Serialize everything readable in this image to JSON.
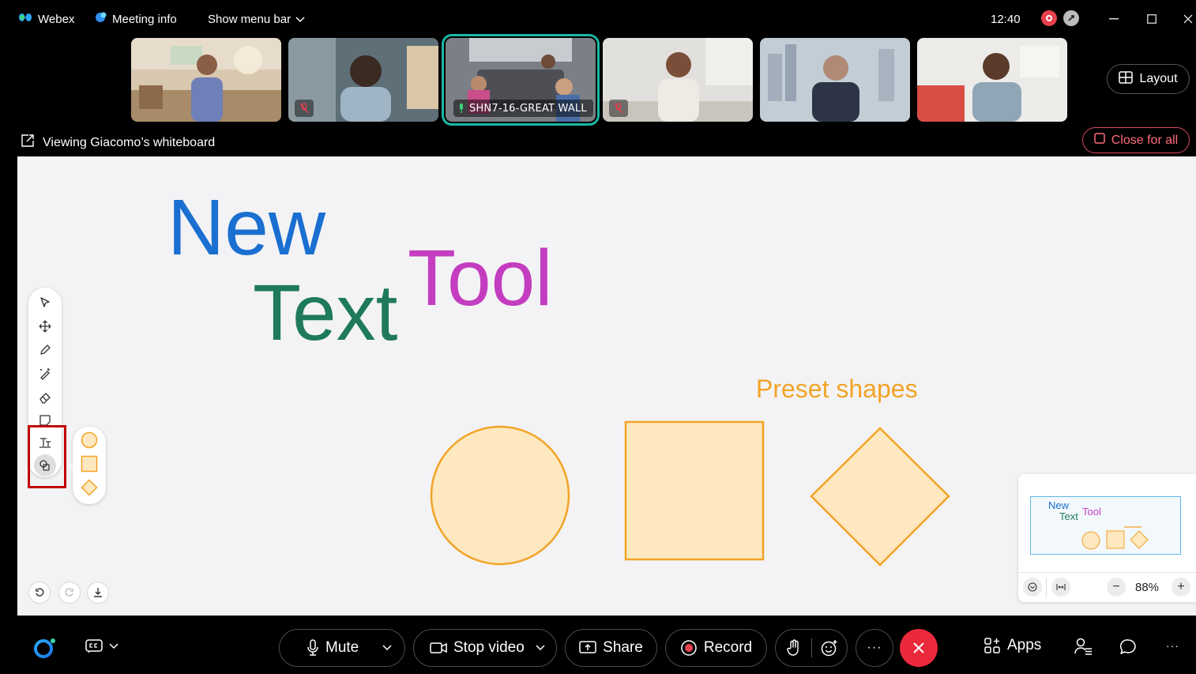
{
  "titlebar": {
    "app_name": "Webex",
    "meeting_info": "Meeting info",
    "show_menu_bar": "Show menu bar",
    "time": "12:40"
  },
  "participants": [
    {
      "muted": false,
      "active": false
    },
    {
      "muted": true,
      "active": false
    },
    {
      "muted": false,
      "active": true,
      "label": "SHN7-16-GREAT WALL"
    },
    {
      "muted": true,
      "active": false
    },
    {
      "muted": false,
      "active": false
    },
    {
      "muted": false,
      "active": false
    }
  ],
  "layout_label": "Layout",
  "close_for_all_label": "Close for all",
  "viewing_label": "Viewing Giacomo’s whiteboard",
  "whiteboard": {
    "text_new": "New",
    "text_text": "Text",
    "text_tool": "Tool",
    "preset_label": "Preset shapes",
    "colors": {
      "blue": "#1a6fd0",
      "green": "#1e7a5a",
      "magenta": "#c43cc0",
      "orange": "#f2a326",
      "shape_fill": "#fde8bf"
    }
  },
  "toolbar": {
    "tools": [
      "select-icon",
      "move-icon",
      "pen-icon",
      "magic-pen-icon",
      "eraser-icon",
      "sticky-note-icon",
      "text-icon",
      "shapes-icon"
    ],
    "shape_options": [
      "circle-icon",
      "square-icon",
      "diamond-icon"
    ]
  },
  "minimap": {
    "mini_new": "New",
    "mini_text": "Text",
    "mini_tool": "Tool",
    "zoom": "88%",
    "minus": "−",
    "plus": "+"
  },
  "bottombar": {
    "mute_label": "Mute",
    "stop_video_label": "Stop video",
    "share_label": "Share",
    "record_label": "Record",
    "apps_label": "Apps",
    "more": "···"
  }
}
